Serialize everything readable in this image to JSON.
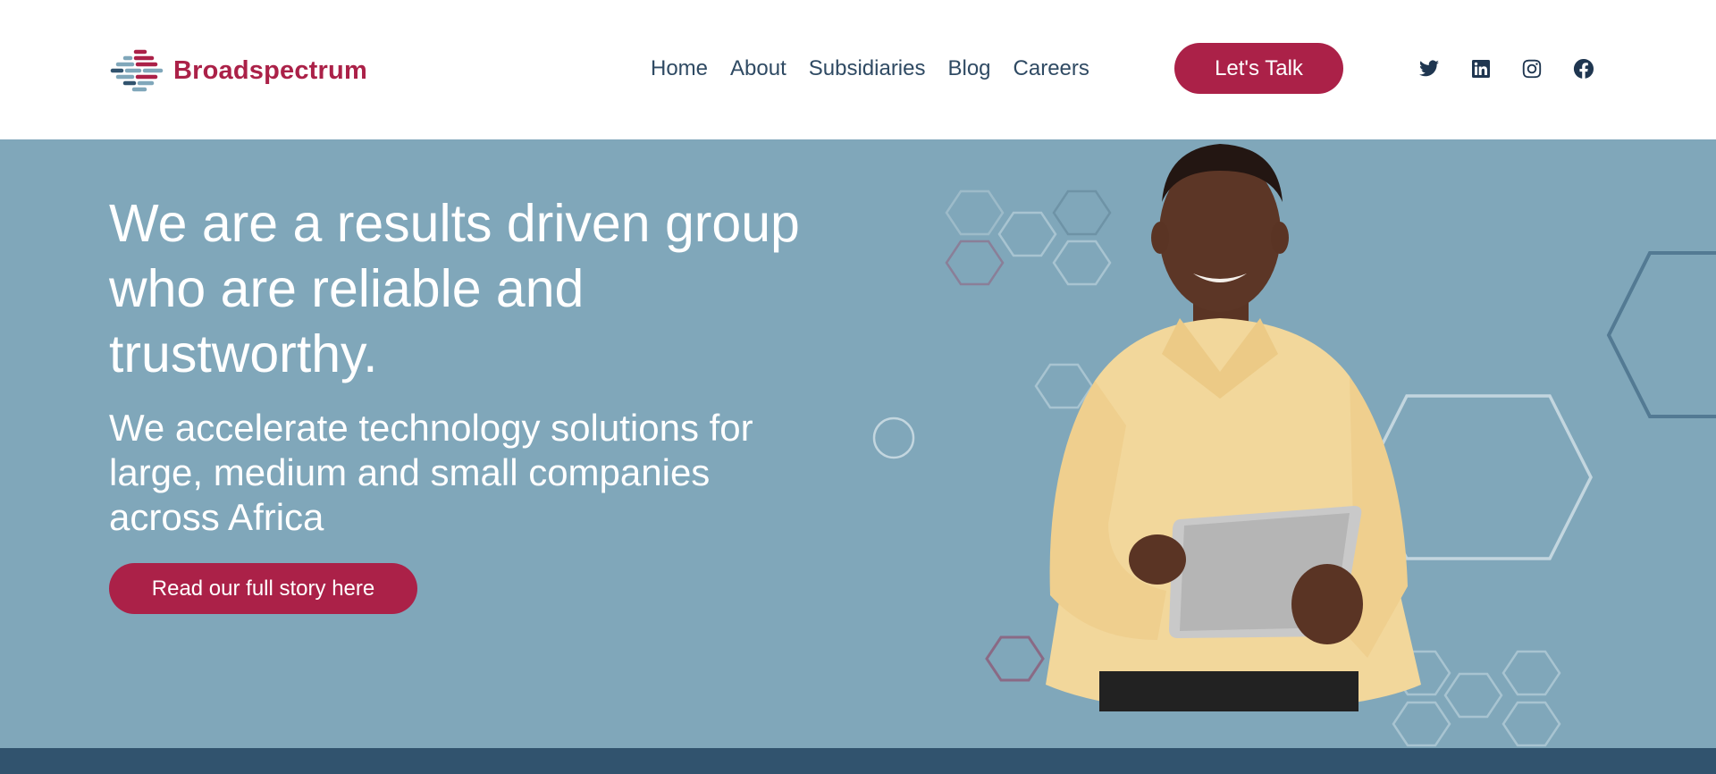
{
  "brand": {
    "name": "Broadspectrum",
    "accent": "#ab2148",
    "hero_bg": "#80a7ba",
    "band": "#31536e"
  },
  "nav": {
    "items": [
      {
        "label": "Home"
      },
      {
        "label": "About"
      },
      {
        "label": "Subsidiaries"
      },
      {
        "label": "Blog"
      },
      {
        "label": "Careers"
      }
    ],
    "cta_label": "Let's Talk"
  },
  "social": [
    "twitter-icon",
    "linkedin-icon",
    "instagram-icon",
    "facebook-icon"
  ],
  "hero": {
    "headline": "We are a results driven group who are reliable and trustworthy.",
    "subline": "We accelerate technology solutions for large, medium and small companies across Africa",
    "button_label": "Read our full story here"
  }
}
